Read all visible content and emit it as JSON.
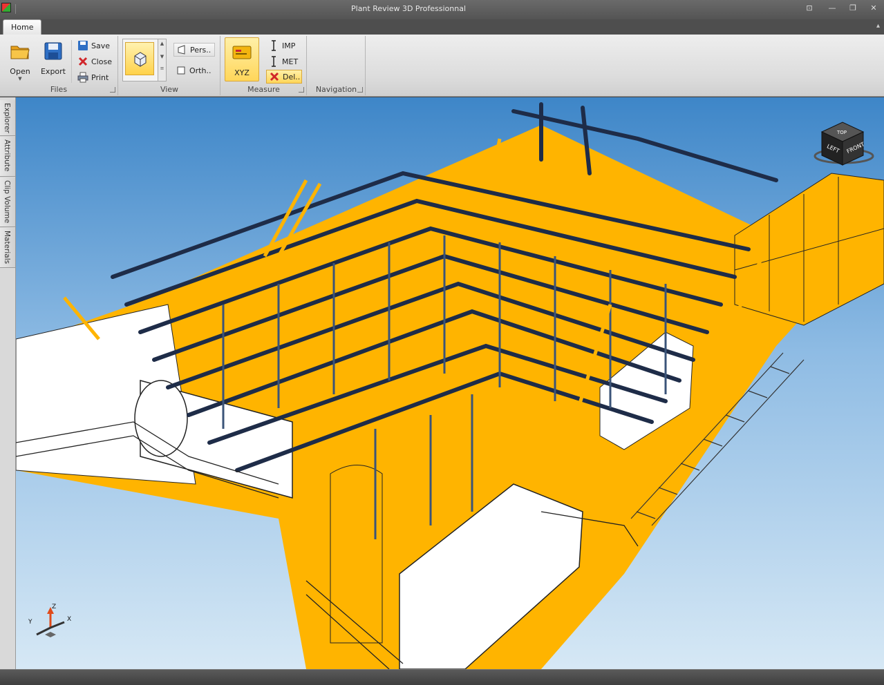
{
  "window": {
    "title": "Plant Review 3D Professionnal",
    "controls": [
      "⊡",
      "—",
      "❐",
      "✕"
    ]
  },
  "tabs": [
    {
      "label": "Home",
      "active": true
    }
  ],
  "ribbon": {
    "files": {
      "label": "Files",
      "open": "Open",
      "export": "Export",
      "save": "Save",
      "close": "Close",
      "print": "Print"
    },
    "view": {
      "label": "View",
      "perspective": "Pers..",
      "orthographic": "Orth.."
    },
    "measure": {
      "label": "Measure",
      "xyz": "XYZ",
      "imp": "IMP",
      "met": "MET",
      "delete": "Del.."
    },
    "navigation": {
      "label": "Navigation"
    }
  },
  "side_tabs": [
    "Explorer",
    "Attribute",
    "Clip Volume",
    "Materials"
  ],
  "viewcube": {
    "left": "LEFT",
    "front": "FRONT",
    "top": "TOP"
  },
  "axis_triad": {
    "x": "X",
    "y": "Y",
    "z": "Z"
  },
  "colors": {
    "deck": "#ffb400",
    "pipe": "#1e2c48",
    "sky_top": "#3e86c8",
    "sky_bottom": "#d6e8f5"
  }
}
